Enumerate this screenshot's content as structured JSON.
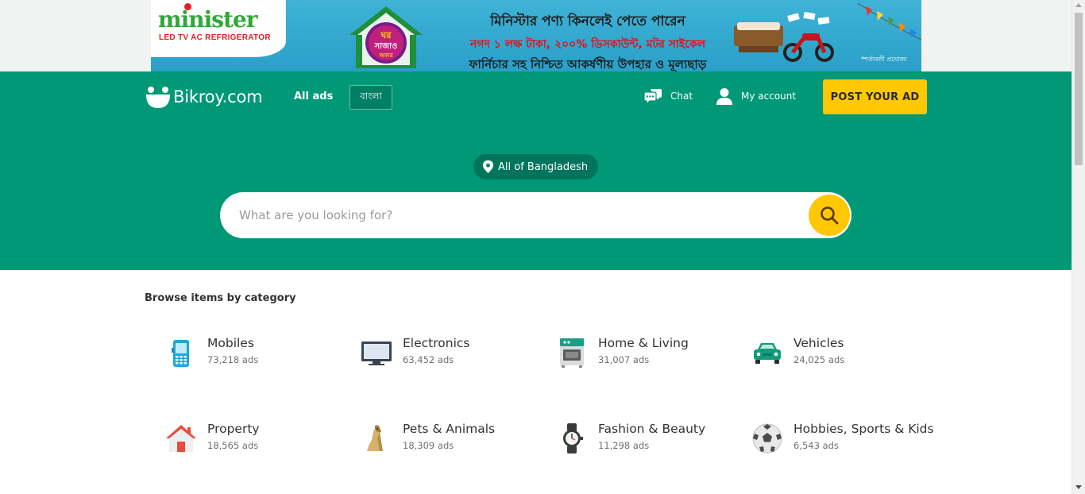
{
  "banner": {
    "brand": "minister",
    "tagline": "LED TV  AC  REFRIGERATOR",
    "house_text_1": "ঘর",
    "house_text_2": "সাজাও",
    "house_text_3": "অফার",
    "line1": "মিনিস্টার পণ্য কিনলেই পেতে পারেন",
    "line2": "নগদ ১ লক্ষ টাকা, ২০০% ডিসকাউন্ট, মটর সাইকেল",
    "line3": "ফার্নিচার সহ নিশ্চিত আকর্ষণীয় উপহার ও মূল্যছাড়",
    "terms": "*শর্তাবলী প্রযোজ্য"
  },
  "header": {
    "logo_text": "Bikroy.com",
    "all_ads": "All ads",
    "language": "বাংলা",
    "chat": "Chat",
    "account": "My account",
    "post_ad": "POST YOUR AD"
  },
  "search": {
    "location": "All of Bangladesh",
    "placeholder": "What are you looking for?"
  },
  "browse": {
    "title": "Browse items by category",
    "categories": [
      {
        "name": "Mobiles",
        "count": "73,218 ads",
        "icon": "mobile-phone-icon"
      },
      {
        "name": "Electronics",
        "count": "63,452 ads",
        "icon": "monitor-icon"
      },
      {
        "name": "Home & Living",
        "count": "31,007 ads",
        "icon": "stove-icon"
      },
      {
        "name": "Vehicles",
        "count": "24,025 ads",
        "icon": "car-icon"
      },
      {
        "name": "Property",
        "count": "18,565 ads",
        "icon": "house-icon"
      },
      {
        "name": "Pets & Animals",
        "count": "18,309 ads",
        "icon": "dog-icon"
      },
      {
        "name": "Fashion & Beauty",
        "count": "11,298 ads",
        "icon": "watch-icon"
      },
      {
        "name": "Hobbies, Sports & Kids",
        "count": "6,543 ads",
        "icon": "soccer-ball-icon"
      }
    ]
  },
  "colors": {
    "brand_green": "#009877",
    "accent_yellow": "#ffc800",
    "pill_green": "#00755c"
  }
}
